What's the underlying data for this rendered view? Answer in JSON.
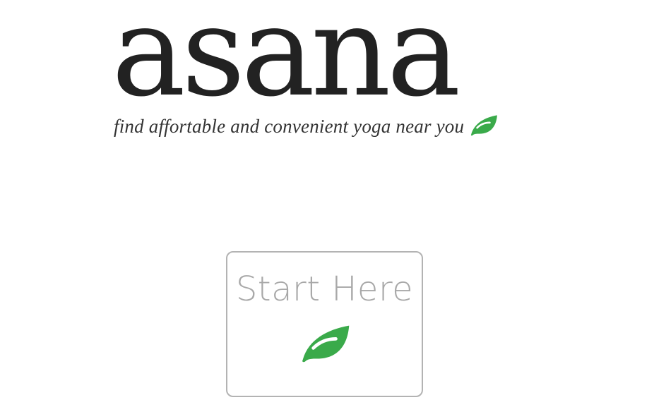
{
  "brand": {
    "title": "asana",
    "tagline": "find affortable and convenient yoga near you"
  },
  "start": {
    "label": "Start Here"
  },
  "icons": {
    "leaf": "leaf-icon"
  },
  "colors": {
    "leaf": "#3aaa4a",
    "title": "#222222",
    "button_border": "#b3b3b3",
    "button_text": "#a8a8a8"
  }
}
